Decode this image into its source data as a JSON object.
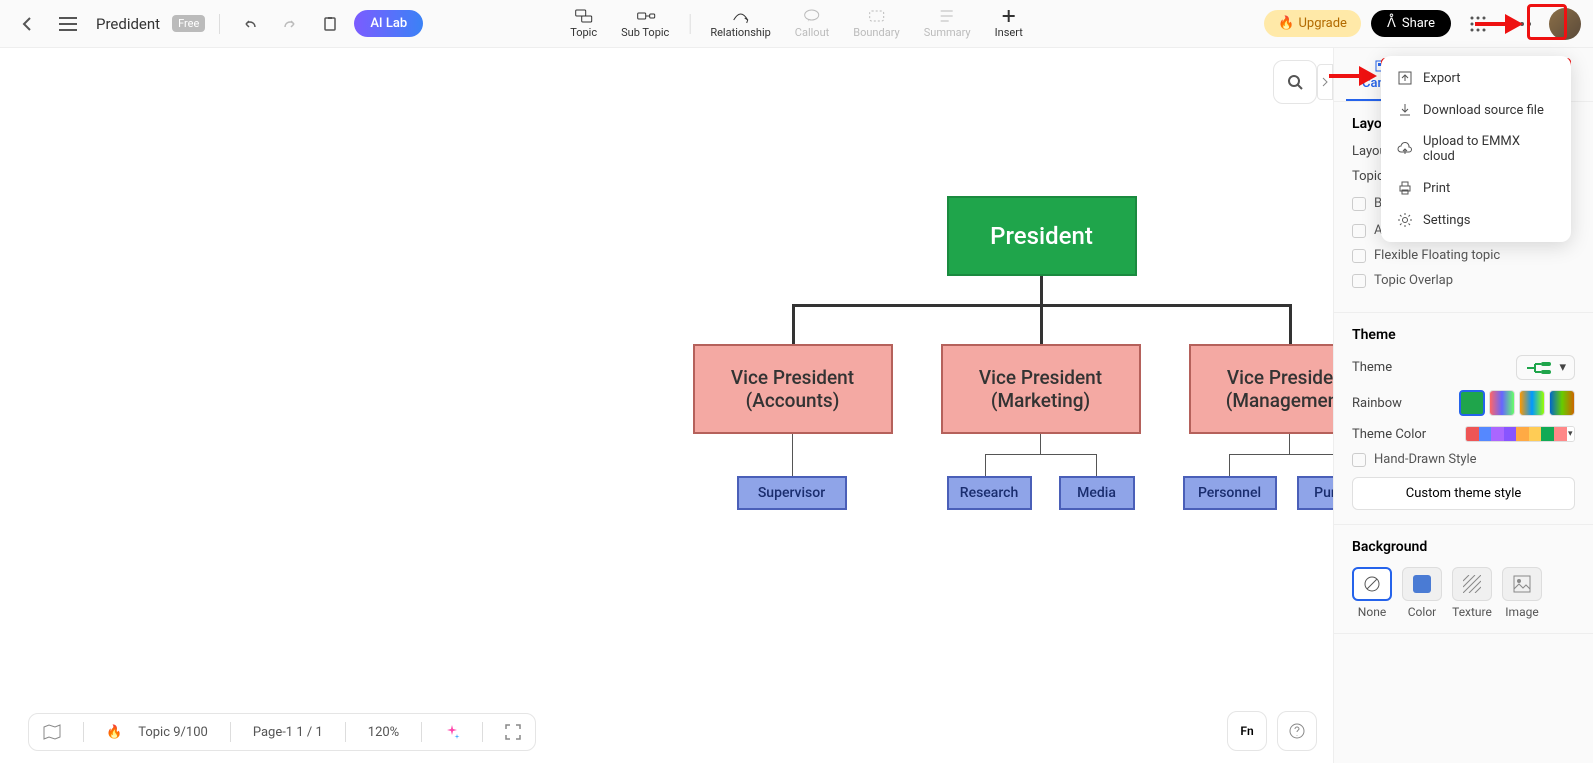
{
  "doc_title": "Predident",
  "badge": "Free",
  "ai_lab": "AI Lab",
  "tools": {
    "topic": "Topic",
    "subtopic": "Sub Topic",
    "relationship": "Relationship",
    "callout": "Callout",
    "boundary": "Boundary",
    "summary": "Summary",
    "insert": "Insert"
  },
  "upgrade": "Upgrade",
  "share": "Share",
  "chart": {
    "root": "President",
    "vp1": {
      "t1": "Vice President",
      "t2": "(Accounts)"
    },
    "vp2": {
      "t1": "Vice President",
      "t2": "(Marketing)"
    },
    "vp3": {
      "t1": "Vice President",
      "t2": "(Management)"
    },
    "leaves": {
      "supervisor": "Supervisor",
      "research": "Research",
      "media": "Media",
      "personnel": "Personnel",
      "purchasing": "Purchasing"
    }
  },
  "panel": {
    "tab": "Canvas",
    "layout_h": "Layout",
    "layout": "Layout",
    "spacing": "Topic Spacing",
    "opt1": "Branch Free Positioning",
    "opt2": "Alignment With Sibling Topic",
    "opt3": "Flexible Floating topic",
    "opt4": "Topic Overlap",
    "theme_h": "Theme",
    "theme": "Theme",
    "rainbow": "Rainbow",
    "theme_color": "Theme Color",
    "hand": "Hand-Drawn Style",
    "custom": "Custom theme style",
    "bg_h": "Background",
    "bg_none": "None",
    "bg_color": "Color",
    "bg_texture": "Texture",
    "bg_image": "Image"
  },
  "menu": {
    "export": "Export",
    "download": "Download source file",
    "upload": "Upload to EMMX cloud",
    "print": "Print",
    "settings": "Settings"
  },
  "bottom": {
    "topic_count": "Topic 9/100",
    "page": "Page-1  1 / 1",
    "zoom": "120%"
  }
}
